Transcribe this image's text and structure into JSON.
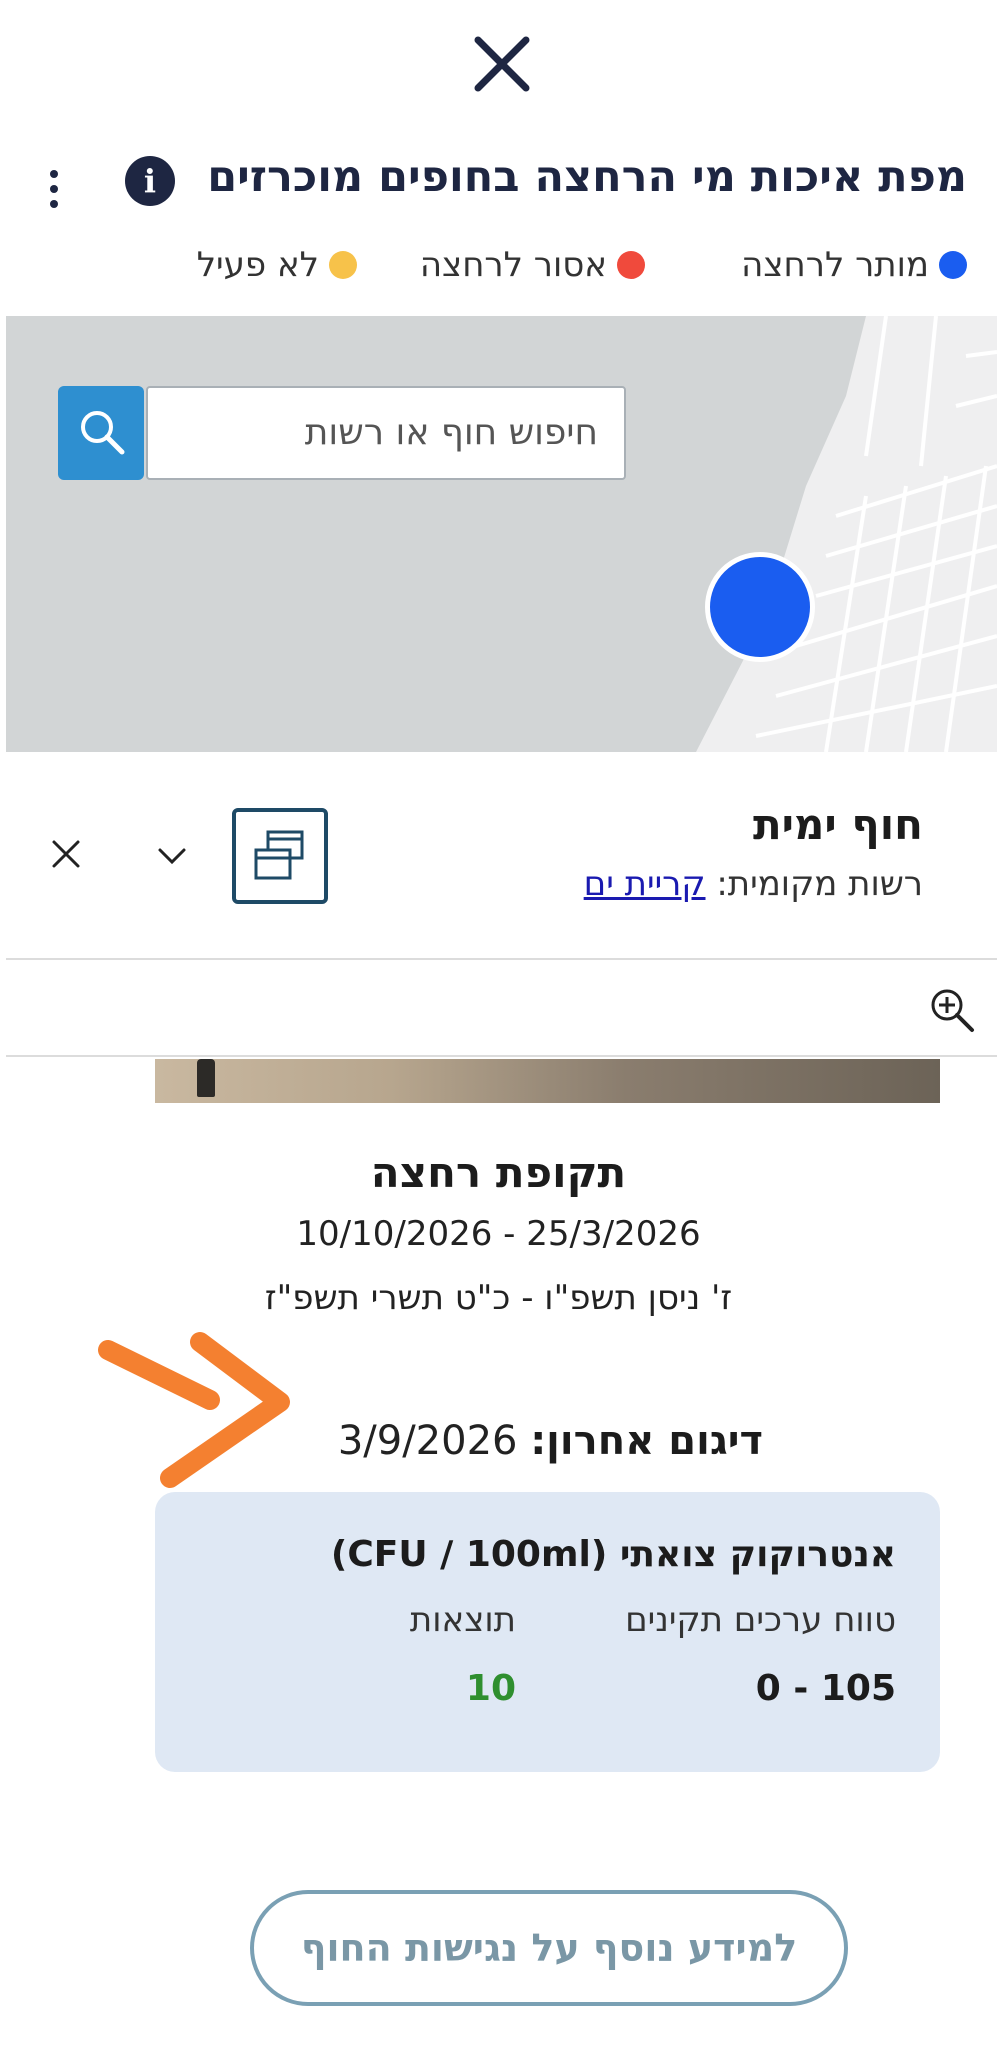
{
  "header": {
    "close_icon": "close-icon",
    "title": "מפת איכות מי הרחצה בחופים מוכרזים",
    "info_icon": "info-icon",
    "info_glyph": "i",
    "more_icon": "kebab-menu-icon"
  },
  "legend": [
    {
      "label": "מותר לרחצה",
      "color": "#1a5df0"
    },
    {
      "label": "אסור לרחצה",
      "color": "#f04a3c"
    },
    {
      "label": "לא פעיל",
      "color": "#f7c24a"
    }
  ],
  "map": {
    "search_placeholder": "חיפוש חוף או רשות",
    "search_icon": "search-icon",
    "marker_color": "#1a5df0",
    "sea_color": "#d2d5d6"
  },
  "beach": {
    "name": "חוף ימית",
    "authority_label": "רשות מקומית:",
    "authority_link": "קריית ים"
  },
  "season": {
    "title": "תקופת רחצה",
    "gregorian_range": "10/10/2026 - 25/3/2026",
    "hebrew_range": "ז' ניסן תשפ\"ו - כ\"ט תשרי תשפ\"ז"
  },
  "last_sample": {
    "label": "דיגום אחרון:",
    "date": "3/9/2026"
  },
  "results": {
    "title": "אנטרוקוק צואתי (CFU / 100ml)",
    "range_header": "טווח ערכים תקינים",
    "result_header": "תוצאות",
    "range_value": "0 - 105",
    "result_value": "10",
    "result_color": "#2f8f2f"
  },
  "more_info_button": "למידע נוסף על נגישות החוף"
}
